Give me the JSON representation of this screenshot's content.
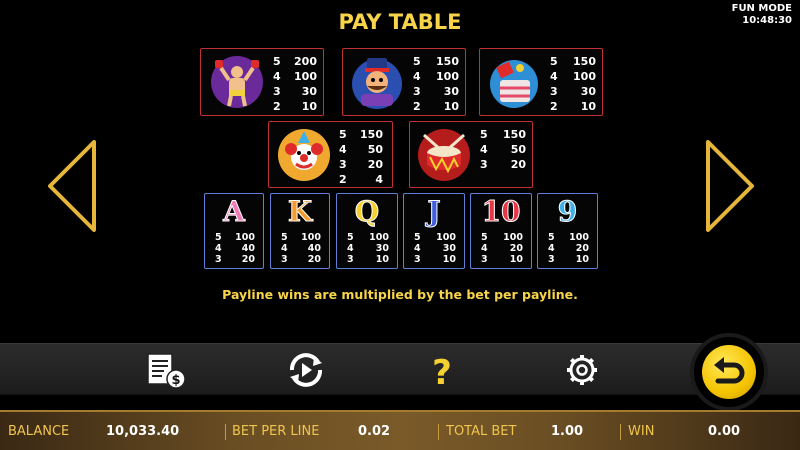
{
  "title": "PAY TABLE",
  "mode": {
    "label": "FUN MODE",
    "time": "10:48:30"
  },
  "note": "Payline wins are multiplied by the bet per payline.",
  "icons": {
    "strongman": "strongman-icon",
    "circus_man": "circus-man-icon",
    "cannon": "cannon-icon",
    "clown": "clown-icon",
    "drum": "drum-icon"
  },
  "paytable_top": [
    {
      "symbol": "strongman",
      "pays": [
        [
          "5",
          "200"
        ],
        [
          "4",
          "100"
        ],
        [
          "3",
          "30"
        ],
        [
          "2",
          "10"
        ]
      ]
    },
    {
      "symbol": "circus_man",
      "pays": [
        [
          "5",
          "150"
        ],
        [
          "4",
          "100"
        ],
        [
          "3",
          "30"
        ],
        [
          "2",
          "10"
        ]
      ]
    },
    {
      "symbol": "cannon",
      "pays": [
        [
          "5",
          "150"
        ],
        [
          "4",
          "100"
        ],
        [
          "3",
          "30"
        ],
        [
          "2",
          "10"
        ]
      ]
    }
  ],
  "paytable_mid": [
    {
      "symbol": "clown",
      "pays": [
        [
          "5",
          "150"
        ],
        [
          "4",
          "50"
        ],
        [
          "3",
          "20"
        ],
        [
          "2",
          "4"
        ]
      ]
    },
    {
      "symbol": "drum",
      "pays": [
        [
          "5",
          "150"
        ],
        [
          "4",
          "50"
        ],
        [
          "3",
          "20"
        ]
      ]
    }
  ],
  "paytable_low": [
    {
      "symbol": "A",
      "color": "#f07ab8",
      "pays": [
        [
          "5",
          "100"
        ],
        [
          "4",
          "40"
        ],
        [
          "3",
          "20"
        ]
      ]
    },
    {
      "symbol": "K",
      "color": "#f59a2e",
      "pays": [
        [
          "5",
          "100"
        ],
        [
          "4",
          "40"
        ],
        [
          "3",
          "20"
        ]
      ]
    },
    {
      "symbol": "Q",
      "color": "#f5d130",
      "pays": [
        [
          "5",
          "100"
        ],
        [
          "4",
          "30"
        ],
        [
          "3",
          "10"
        ]
      ]
    },
    {
      "symbol": "J",
      "color": "#3f5ee0",
      "pays": [
        [
          "5",
          "100"
        ],
        [
          "4",
          "30"
        ],
        [
          "3",
          "10"
        ]
      ]
    },
    {
      "symbol": "10",
      "color": "#e63545",
      "pays": [
        [
          "5",
          "100"
        ],
        [
          "4",
          "20"
        ],
        [
          "3",
          "10"
        ]
      ]
    },
    {
      "symbol": "9",
      "color": "#3fb1ea",
      "pays": [
        [
          "5",
          "100"
        ],
        [
          "4",
          "20"
        ],
        [
          "3",
          "10"
        ]
      ]
    }
  ],
  "toolbar": {
    "buttons": [
      "paytable-money-icon",
      "autoplay-icon",
      "help-icon",
      "settings-icon"
    ],
    "help_glyph": "?"
  },
  "status": {
    "balance_label": "BALANCE",
    "balance_value": "10,033.40",
    "bet_label": "BET PER LINE",
    "bet_value": "0.02",
    "total_label": "TOTAL BET",
    "total_value": "1.00",
    "win_label": "WIN",
    "win_value": "0.00"
  },
  "colors": {
    "gold": "#f7d44a",
    "card_border_red": "#c03232",
    "card_border_blue": "#5f7fd6"
  }
}
